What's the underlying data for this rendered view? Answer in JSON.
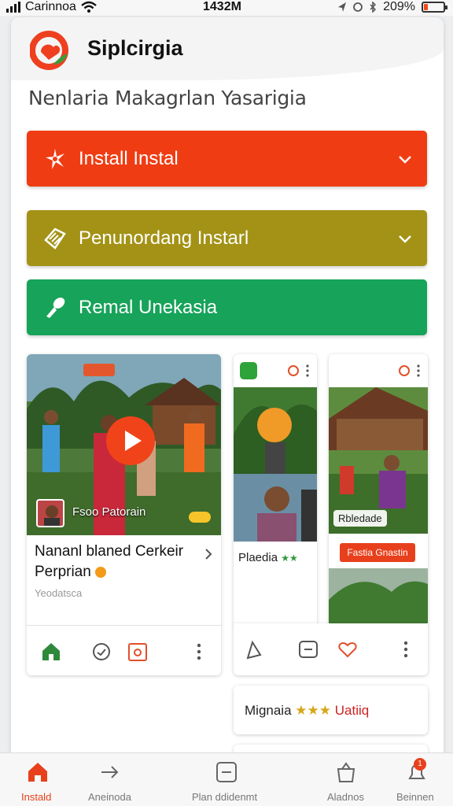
{
  "status_bar": {
    "carrier": "Carinnoa",
    "time": "1432M",
    "battery": "209%",
    "battery_level": 0.2
  },
  "header": {
    "app_title": "Siplcirgia",
    "subtitle": "Nenlaria Makagrlan Yasarigia"
  },
  "actions": [
    {
      "label": "Install Instal",
      "icon": "spark-icon",
      "color": "#f03c13"
    },
    {
      "label": "Penunordang Instarl",
      "icon": "tag-icon",
      "color": "#a39216"
    },
    {
      "label": "Remal Unekasia",
      "icon": "key-icon",
      "color": "#17a35a"
    }
  ],
  "cards": {
    "video": {
      "overlay_label": "Fsoo Patorain",
      "title_line1": "Nananl blaned Cerkeir",
      "title_line2": "Perprian",
      "meta": "Yeodatsca"
    },
    "middle": {
      "caption": "Plaedia",
      "stars": "★★"
    },
    "right": {
      "overlay_label": "Rbledade",
      "action_label": "Fastia Gnastin"
    },
    "bottom": {
      "text": "Mignaia",
      "stars": "★★★",
      "suffix": "Uatiiq"
    }
  },
  "colors": {
    "accent_red": "#f03c13",
    "olive": "#a39216",
    "green": "#17a35a",
    "nav_active": "#e8401c"
  },
  "bottom_nav": [
    {
      "label": "Instald",
      "icon": "home-icon",
      "active": true
    },
    {
      "label": "Aneinoda",
      "icon": "arrow-icon",
      "active": false
    },
    {
      "label": "Plan ddidenmt",
      "icon": "minus-box-icon",
      "active": false
    },
    {
      "label": "Aladnos",
      "icon": "bag-icon",
      "active": false
    },
    {
      "label": "Beinnen",
      "icon": "bell-icon",
      "active": false,
      "badge": "1"
    }
  ]
}
